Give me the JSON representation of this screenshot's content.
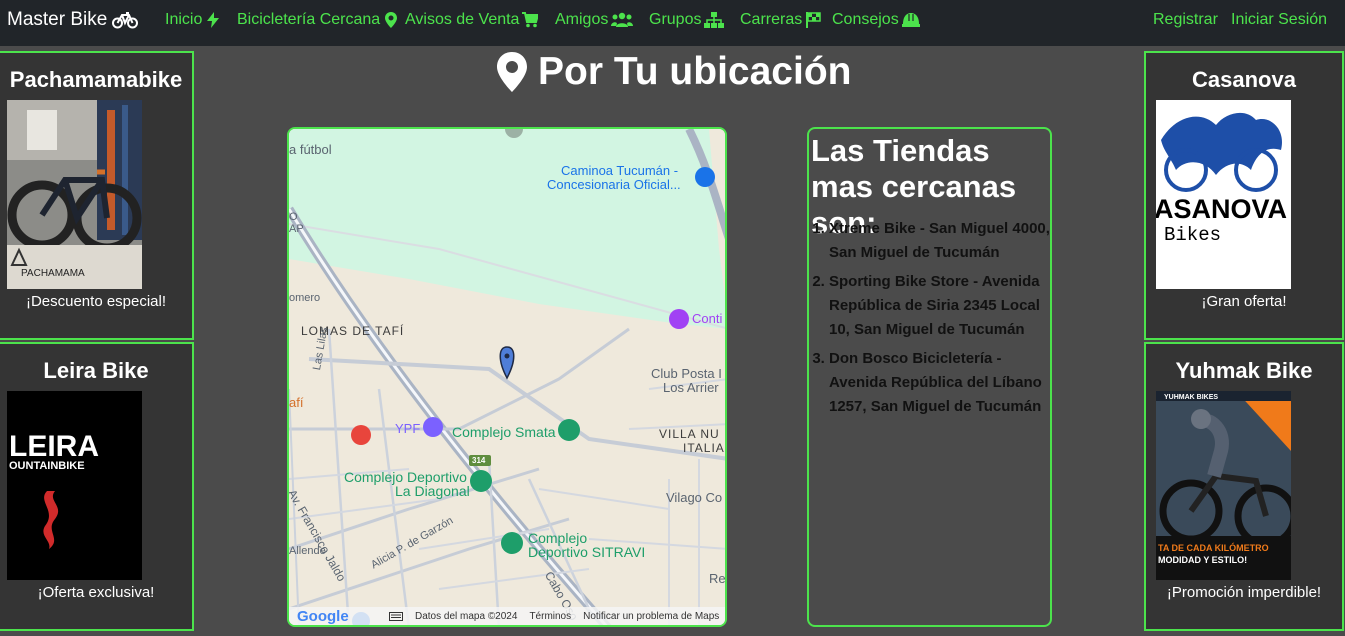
{
  "navbar": {
    "brand": "Master Bike",
    "items": [
      {
        "label": "Inicio"
      },
      {
        "label": "Bicicletería Cercana"
      },
      {
        "label": "Avisos de Venta"
      },
      {
        "label": "Amigos"
      },
      {
        "label": "Grupos"
      },
      {
        "label": "Carreras"
      },
      {
        "label": "Consejos"
      }
    ],
    "register": "Registrar",
    "login": "Iniciar Sesión"
  },
  "ads": {
    "top_left": {
      "title": "Pachamamabike",
      "caption": "¡Descuento especial!",
      "logo_text": "PACHAMAMA"
    },
    "bottom_left": {
      "title": "Leira Bike",
      "caption": "¡Oferta exclusiva!",
      "logo_text": "LEIRA",
      "logo_sub": "OUNTAINBIKE"
    },
    "top_right": {
      "title": "Casanova",
      "caption": "¡Gran oferta!",
      "logo_text": "ASANOVA",
      "logo_sub": "Bikes"
    },
    "bottom_right": {
      "title": "Yuhmak Bike",
      "caption": "¡Promoción imperdible!",
      "logo_text": "YUHMAK BIKES",
      "promo_line1": "TA DE CADA KILÓMETRO",
      "promo_line2": "MODIDAD Y ESTILO!"
    }
  },
  "main": {
    "title": "Por Tu ubicación"
  },
  "map": {
    "labels": {
      "futbol": "a fútbol",
      "caminoa1": "Caminoa Tucumán -",
      "caminoa2": "Concesionaria Oficial...",
      "lomas": "LOMAS DE TAFÍ",
      "club1": "Club Posta I",
      "club2": "Los Arrier",
      "conti": "Conti",
      "ypf": "YPF",
      "smata": "Complejo Smata",
      "villa1": "VILLA NU",
      "villa2": "ITALIA",
      "diagonal1": "Complejo Deportivo",
      "diagonal2": "La Diagonal",
      "sitravi1": "Complejo",
      "sitravi2": "Deportivo SITRAVI",
      "vilago": "Vilago Co",
      "jaldo": "Av. Francisco Jaldo",
      "garzon": "Alicia P. de Garzón",
      "cabo": "Cabo Oso",
      "lilas": "Las Lilas",
      "allende": "Allende",
      "romero": "omero",
      "ap": "AP",
      "o": "O",
      "tafi": "afí",
      "route": "314",
      "re": "Re"
    },
    "footer": {
      "google": "Google",
      "data": "Datos del mapa ©2024",
      "terms": "Términos",
      "report": "Notificar un problema de Maps"
    }
  },
  "stores": {
    "title": "Las Tiendas mas cercanas son:",
    "items": [
      "Xtreme Bike - San Miguel 4000, San Miguel de Tucumán",
      "Sporting Bike Store - Avenida República de Siria 2345 Local 10, San Miguel de Tucumán",
      "Don Bosco Bicicletería - Avenida República del Líbano 1257, San Miguel de Tucumán"
    ]
  },
  "colors": {
    "accent": "#4ce34c",
    "navbar_bg": "#212529",
    "page_bg": "#4b4b4b",
    "ad_bg": "#343434"
  }
}
